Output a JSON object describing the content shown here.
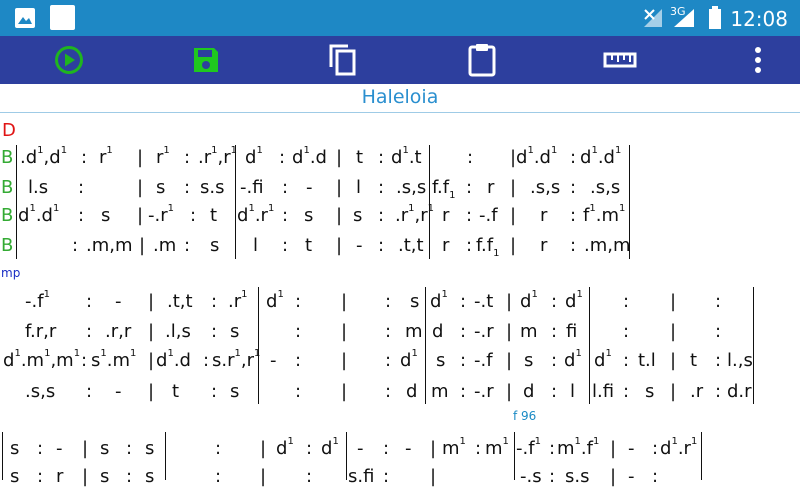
{
  "status": {
    "time": "12:08",
    "network": "3G"
  },
  "toolbar": {
    "play": "play-icon",
    "save": "save-icon",
    "copy": "copy-icon",
    "paste": "clipboard-icon",
    "ruler": "ruler-icon",
    "more": "more-vert-icon"
  },
  "song": {
    "title": "Haleloia",
    "key": "D",
    "voice_label": "B",
    "dyn_mp": "mp",
    "dyn_f96": "f 96"
  },
  "colors": {
    "status": "#1e88c5",
    "toolbar": "#2d3f9e",
    "play": "#1fb51f",
    "title": "#2a8fcf",
    "key": "#e01414",
    "voice": "#33aa33",
    "dyn": "#1a2ec4"
  }
}
